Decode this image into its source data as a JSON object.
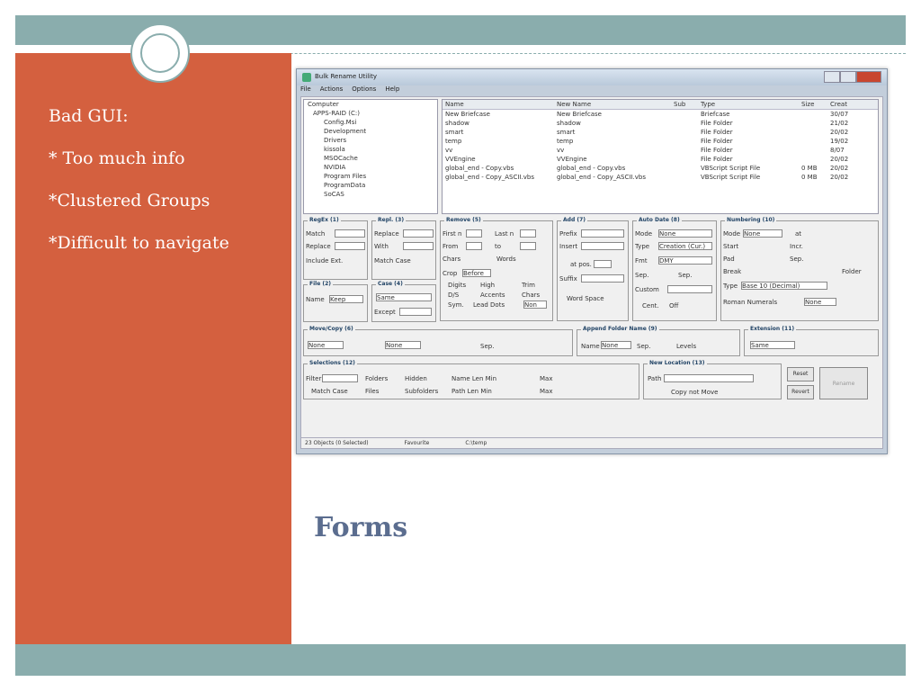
{
  "slide": {
    "title": "Forms",
    "bullets": [
      "Bad GUI:",
      "* Too much info",
      "*Clustered  Groups",
      "*Difficult to navigate"
    ]
  },
  "screenshot": {
    "window_title": "Bulk Rename Utility",
    "menu": [
      "File",
      "Actions",
      "Options",
      "Help"
    ],
    "tree": [
      "Computer",
      "APPS-RAID (C:)",
      "Config.Msi",
      "Development",
      "Drivers",
      "kissola",
      "MSOCache",
      "NVIDIA",
      "Program Files",
      "ProgramData",
      "SoCAS"
    ],
    "file_columns": [
      "Name",
      "New Name",
      "Sub",
      "Type",
      "Size",
      "Creat"
    ],
    "files": [
      {
        "name": "New Briefcase",
        "new_name": "New Briefcase",
        "type": "Briefcase",
        "size": "",
        "created": "30/07"
      },
      {
        "name": "shadow",
        "new_name": "shadow",
        "type": "File Folder",
        "size": "",
        "created": "21/02"
      },
      {
        "name": "smart",
        "new_name": "smart",
        "type": "File Folder",
        "size": "",
        "created": "20/02"
      },
      {
        "name": "temp",
        "new_name": "temp",
        "type": "File Folder",
        "size": "",
        "created": "19/02"
      },
      {
        "name": "vv",
        "new_name": "vv",
        "type": "File Folder",
        "size": "",
        "created": "8/07"
      },
      {
        "name": "VVEngine",
        "new_name": "VVEngine",
        "type": "File Folder",
        "size": "",
        "created": "20/02"
      },
      {
        "name": "global_end - Copy.vbs",
        "new_name": "global_end - Copy.vbs",
        "type": "VBScript Script File",
        "size": "0 MB",
        "created": "20/02"
      },
      {
        "name": "global_end - Copy_ASCII.vbs",
        "new_name": "global_end - Copy_ASCII.vbs",
        "type": "VBScript Script File",
        "size": "0 MB",
        "created": "20/02"
      }
    ],
    "groups": {
      "regex": "RegEx (1)",
      "repl": "Repl. (3)",
      "remove": "Remove (5)",
      "add": "Add (7)",
      "autodate": "Auto Date (8)",
      "numbering": "Numbering (10)",
      "file": "File (2)",
      "case": "Case (4)",
      "movecopy": "Move/Copy (6)",
      "append": "Append Folder Name (9)",
      "extension": "Extension (11)",
      "selections": "Selections (12)",
      "newlocation": "New Location (13)"
    },
    "labels": {
      "match": "Match",
      "replace": "Replace",
      "include_ext": "Include Ext.",
      "with": "With",
      "match_case": "Match Case",
      "name": "Name",
      "keep": "Keep",
      "same": "Same",
      "except": "Except",
      "none": "None",
      "filter": "Filter",
      "folders": "Folders",
      "files": "Files",
      "hidden": "Hidden",
      "subfolders": "Subfolders",
      "path": "Path",
      "copy_not_move": "Copy not Move",
      "reset": "Reset",
      "revert": "Revert",
      "rename": "Rename",
      "mode": "Mode",
      "prefix": "Prefix",
      "insert": "Insert",
      "suffix": "Suffix",
      "word_space": "Word Space",
      "fmt": "Fmt",
      "sep": "Sep.",
      "custom": "Custom",
      "cent": "Cent.",
      "off": "Off",
      "start": "Start",
      "incr": "Incr.",
      "pad": "Pad",
      "break": "Break",
      "folder": "Folder",
      "type": "Type",
      "type_value": "Base 10 (Decimal)",
      "roman": "Roman Numerals",
      "date_type": "Creation (Cur.)",
      "date_fmt": "DMY",
      "levels": "Levels",
      "first_n": "First n",
      "last_n": "Last n",
      "from": "From",
      "to": "to",
      "chars": "Chars",
      "words": "Words",
      "crop": "Crop",
      "before": "Before",
      "digits": "Digits",
      "high": "High",
      "trim": "Trim",
      "ds": "D/S",
      "accents": "Accents",
      "chars_opt": "Chars",
      "sym": "Sym.",
      "lead_dots": "Lead Dots",
      "non": "Non",
      "at_pos": "at pos.",
      "at": "at",
      "name_len_min": "Name Len Min",
      "path_len_min": "Path Len Min",
      "max": "Max"
    },
    "status": [
      "23 Objects (0 Selected)",
      "Favourite",
      "C:\\temp"
    ]
  }
}
